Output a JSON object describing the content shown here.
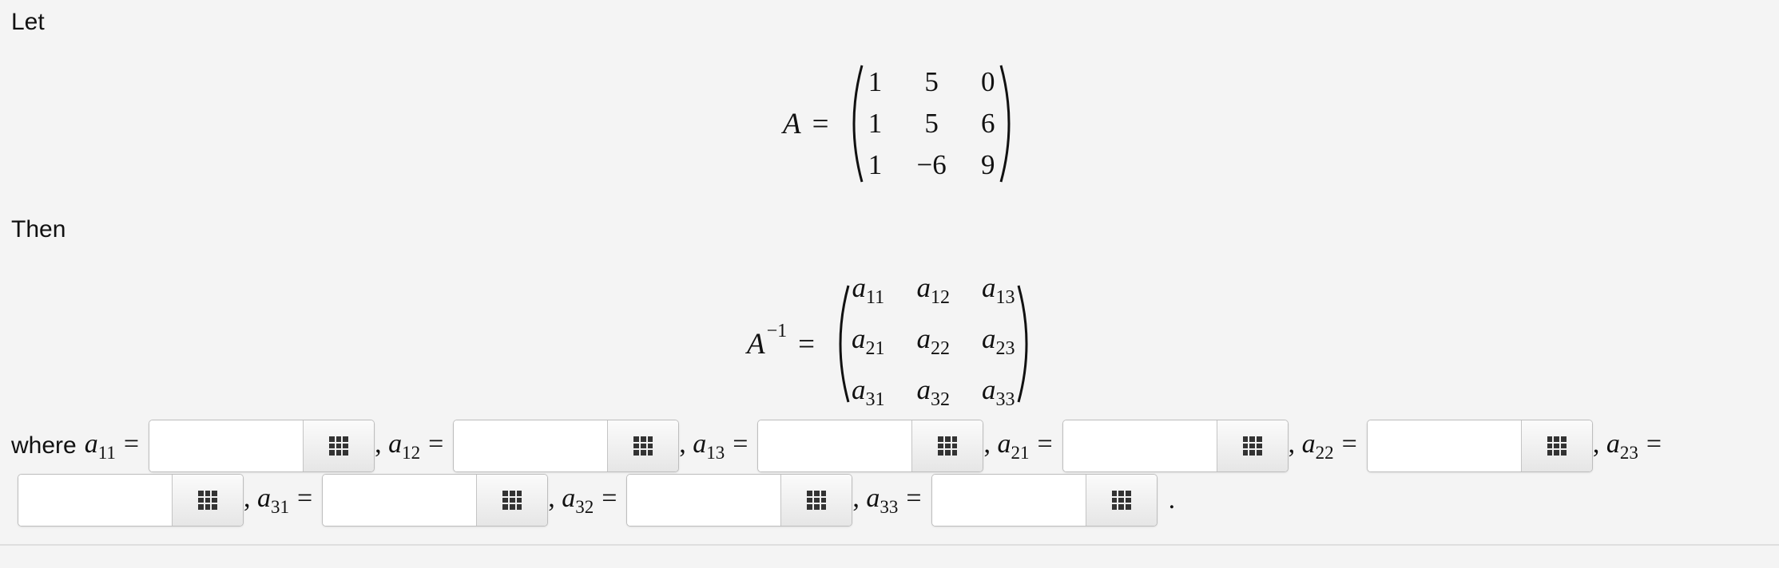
{
  "text": {
    "let": "Let",
    "then": "Then",
    "where": "where",
    "period": "."
  },
  "matrixA": {
    "lhs": "A",
    "equals": "=",
    "rows": [
      [
        "1",
        "5",
        "0"
      ],
      [
        "1",
        "5",
        "6"
      ],
      [
        "1",
        "−6",
        "9"
      ]
    ]
  },
  "matrixInv": {
    "lhs": "A",
    "sup": "−1",
    "equals": "=",
    "rows": [
      [
        {
          "v": "a",
          "s": "11"
        },
        {
          "v": "a",
          "s": "12"
        },
        {
          "v": "a",
          "s": "13"
        }
      ],
      [
        {
          "v": "a",
          "s": "21"
        },
        {
          "v": "a",
          "s": "22"
        },
        {
          "v": "a",
          "s": "23"
        }
      ],
      [
        {
          "v": "a",
          "s": "31"
        },
        {
          "v": "a",
          "s": "32"
        },
        {
          "v": "a",
          "s": "33"
        }
      ]
    ]
  },
  "fields": [
    {
      "var": "a",
      "sub": "11",
      "prefix": "",
      "value": ""
    },
    {
      "var": "a",
      "sub": "12",
      "prefix": ",",
      "value": ""
    },
    {
      "var": "a",
      "sub": "13",
      "prefix": ",",
      "value": ""
    },
    {
      "var": "a",
      "sub": "21",
      "prefix": ",",
      "value": ""
    },
    {
      "var": "a",
      "sub": "22",
      "prefix": ",",
      "value": ""
    },
    {
      "var": "a",
      "sub": "23",
      "prefix": ",",
      "value": ""
    },
    {
      "var": "a",
      "sub": "31",
      "prefix": ",",
      "value": ""
    },
    {
      "var": "a",
      "sub": "32",
      "prefix": ",",
      "value": ""
    },
    {
      "var": "a",
      "sub": "33",
      "prefix": ",",
      "value": ""
    }
  ],
  "icons": {
    "palette": "grid-palette-icon"
  }
}
